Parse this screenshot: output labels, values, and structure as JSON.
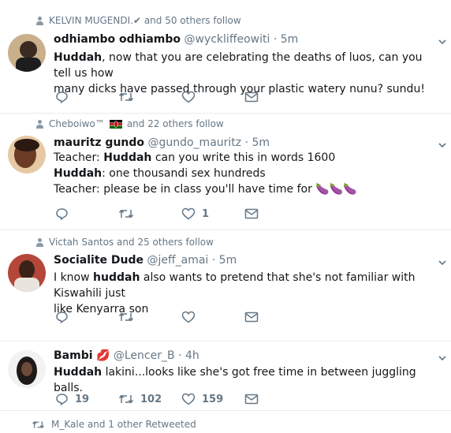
{
  "tweets": [
    {
      "context": "KELVIN MUGENDI.✔ and 50 others follow",
      "name": "odhiambo odhiambo",
      "handle": "@wyckliffeowiti",
      "time": "· 5m",
      "lines": [
        {
          "bold": "Huddah",
          "text": ", now that you are celebrating the deaths of luos, can you tell us how"
        },
        {
          "bold": "",
          "text": "many dicks have passed through your plastic watery nunu? sundu!"
        }
      ],
      "reply_count": "",
      "retweet_count": "",
      "like_count": ""
    },
    {
      "context_name": "Cheboiwo™",
      "context_rest": "and 22 others follow",
      "name": "mauritz gundo",
      "handle": "@gundo_mauritz",
      "time": "· 5m",
      "lines": [
        {
          "pre": "Teacher: ",
          "bold": "Huddah",
          "text": " can you write this in words 1600"
        },
        {
          "pre": "",
          "bold": "Huddah",
          "text": ": one thousandi sex hundreds"
        },
        {
          "pre": "Teacher: please be in class you'll have time for ",
          "bold": "",
          "text": ""
        }
      ],
      "emoji": "🍆🍆🍆",
      "reply_count": "",
      "retweet_count": "",
      "like_count": "1"
    },
    {
      "context": "Victah Santos and 25 others follow",
      "name": "Socialite Dude",
      "handle": "@jeff_amai",
      "time": "· 5m",
      "lines": [
        {
          "pre": "I know ",
          "bold": "huddah",
          "text": " also wants to pretend that she's not familiar with Kiswahili just"
        },
        {
          "pre": "like Kenyarra son",
          "bold": "",
          "text": ""
        }
      ],
      "reply_count": "",
      "retweet_count": "",
      "like_count": ""
    },
    {
      "name": "Bambi",
      "name_emoji": "💋",
      "handle": "@Lencer_B",
      "time": "· 4h",
      "lines": [
        {
          "pre": "",
          "bold": "Huddah",
          "text": " lakini...looks like she's got free time in between juggling balls."
        }
      ],
      "reply_count": "19",
      "retweet_count": "102",
      "like_count": "159"
    }
  ],
  "footer": {
    "text": "M_Kale and 1 other Retweeted"
  },
  "colors": {
    "icon": "#657786",
    "border": "#e6ecf0",
    "flag_green": "#006600",
    "flag_red": "#bb0000"
  },
  "icons": [
    "person-icon",
    "reply-icon",
    "retweet-icon",
    "like-icon",
    "message-icon",
    "chevron-down-icon",
    "kenya-flag-icon"
  ]
}
